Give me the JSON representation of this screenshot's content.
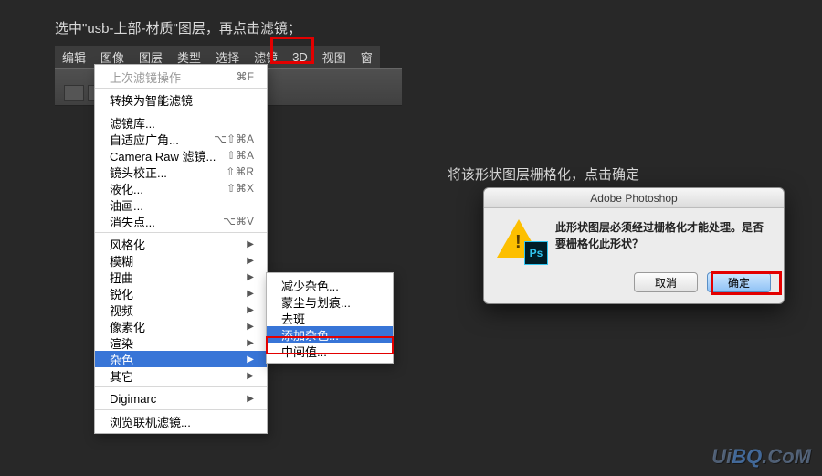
{
  "instruction1": "选中\"usb-上部-材质\"图层，再点击滤镜；",
  "instruction2": "将该形状图层栅格化，点击确定",
  "menubar": {
    "items": [
      "编辑",
      "图像",
      "图层",
      "类型",
      "选择",
      "滤镜",
      "3D",
      "视图",
      "窗"
    ]
  },
  "filter_menu": {
    "last_op": {
      "label": "上次滤镜操作",
      "shortcut": "⌘F"
    },
    "smart": "转换为智能滤镜",
    "gallery": "滤镜库...",
    "adaptive": {
      "label": "自适应广角...",
      "shortcut": "⌥⇧⌘A"
    },
    "camera_raw": {
      "label": "Camera Raw 滤镜...",
      "shortcut": "⇧⌘A"
    },
    "lens": {
      "label": "镜头校正...",
      "shortcut": "⇧⌘R"
    },
    "liquify": {
      "label": "液化...",
      "shortcut": "⇧⌘X"
    },
    "oil": "油画...",
    "vanish": {
      "label": "消失点...",
      "shortcut": "⌥⌘V"
    },
    "stylize": "风格化",
    "blur": "模糊",
    "distort": "扭曲",
    "sharpen": "锐化",
    "video": "视频",
    "pixelate": "像素化",
    "render": "渲染",
    "noise": "杂色",
    "other": "其它",
    "digimarc": "Digimarc",
    "browse": "浏览联机滤镜..."
  },
  "noise_submenu": {
    "reduce": "减少杂色...",
    "dust": "蒙尘与划痕...",
    "despeckle": "去斑",
    "add": "添加杂色...",
    "median": "中间值..."
  },
  "dialog": {
    "title": "Adobe Photoshop",
    "message": "此形状图层必须经过栅格化才能处理。是否要栅格化此形状？",
    "cancel": "取消",
    "ok": "确定",
    "ps": "Ps"
  },
  "watermark": {
    "a": "Ui",
    "b": "BQ",
    "c": ".CoM"
  }
}
